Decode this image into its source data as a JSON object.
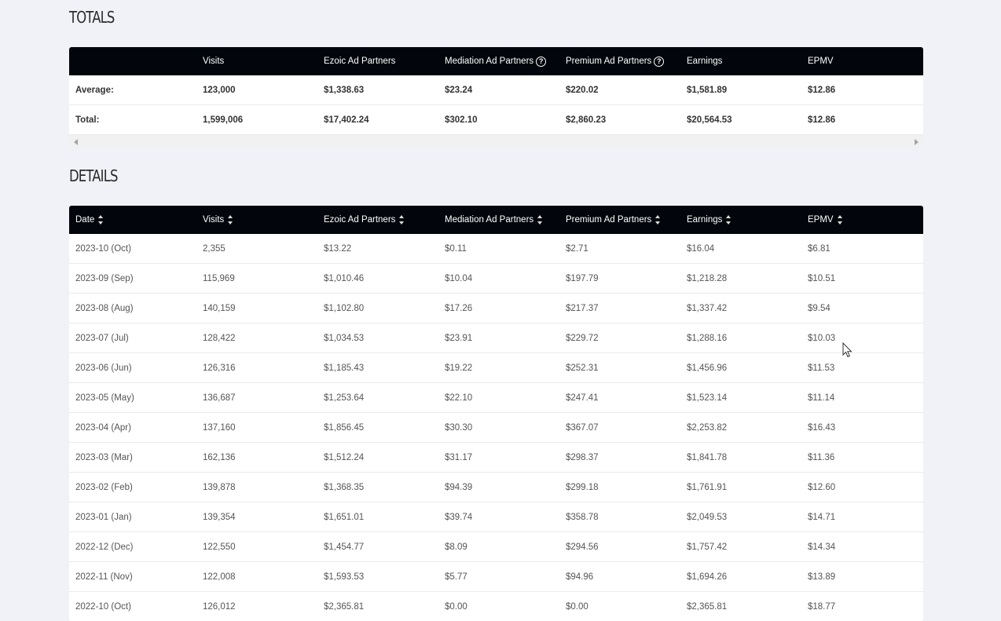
{
  "totals": {
    "title": "TOTALS",
    "headers": [
      "",
      "Visits",
      "Ezoic Ad Partners",
      "Mediation Ad Partners",
      "Premium Ad Partners",
      "Earnings",
      "EPMV"
    ],
    "rows": [
      [
        "Average:",
        "123,000",
        "$1,338.63",
        "$23.24",
        "$220.02",
        "$1,581.89",
        "$12.86"
      ],
      [
        "Total:",
        "1,599,006",
        "$17,402.24",
        "$302.10",
        "$2,860.23",
        "$20,564.53",
        "$12.86"
      ]
    ],
    "help_icon_glyph": "?"
  },
  "details": {
    "title": "DETAILS",
    "headers": [
      "Date",
      "Visits",
      "Ezoic Ad Partners",
      "Mediation Ad Partners",
      "Premium Ad Partners",
      "Earnings",
      "EPMV"
    ],
    "rows": [
      [
        "2023-10 (Oct)",
        "2,355",
        "$13.22",
        "$0.11",
        "$2.71",
        "$16.04",
        "$6.81"
      ],
      [
        "2023-09 (Sep)",
        "115,969",
        "$1,010.46",
        "$10.04",
        "$197.79",
        "$1,218.28",
        "$10.51"
      ],
      [
        "2023-08 (Aug)",
        "140,159",
        "$1,102.80",
        "$17.26",
        "$217.37",
        "$1,337.42",
        "$9.54"
      ],
      [
        "2023-07 (Jul)",
        "128,422",
        "$1,034.53",
        "$23.91",
        "$229.72",
        "$1,288.16",
        "$10.03"
      ],
      [
        "2023-06 (Jun)",
        "126,316",
        "$1,185.43",
        "$19.22",
        "$252.31",
        "$1,456.96",
        "$11.53"
      ],
      [
        "2023-05 (May)",
        "136,687",
        "$1,253.64",
        "$22.10",
        "$247.41",
        "$1,523.14",
        "$11.14"
      ],
      [
        "2023-04 (Apr)",
        "137,160",
        "$1,856.45",
        "$30.30",
        "$367.07",
        "$2,253.82",
        "$16.43"
      ],
      [
        "2023-03 (Mar)",
        "162,136",
        "$1,512.24",
        "$31.17",
        "$298.37",
        "$1,841.78",
        "$11.36"
      ],
      [
        "2023-02 (Feb)",
        "139,878",
        "$1,368.35",
        "$94.39",
        "$299.18",
        "$1,761.91",
        "$12.60"
      ],
      [
        "2023-01 (Jan)",
        "139,354",
        "$1,651.01",
        "$39.74",
        "$358.78",
        "$2,049.53",
        "$14.71"
      ],
      [
        "2022-12 (Dec)",
        "122,550",
        "$1,454.77",
        "$8.09",
        "$294.56",
        "$1,757.42",
        "$14.34"
      ],
      [
        "2022-11 (Nov)",
        "122,008",
        "$1,593.53",
        "$5.77",
        "$94.96",
        "$1,694.26",
        "$13.89"
      ],
      [
        "2022-10 (Oct)",
        "126,012",
        "$2,365.81",
        "$0.00",
        "$0.00",
        "$2,365.81",
        "$18.77"
      ]
    ]
  },
  "icons": {
    "help": "help-circle-icon",
    "sort": "sort-updown-icon",
    "cursor": "mouse-pointer-icon"
  },
  "colors": {
    "header_bg": "#02060c",
    "page_bg": "#f1f2f7",
    "card_bg": "#ffffff"
  }
}
